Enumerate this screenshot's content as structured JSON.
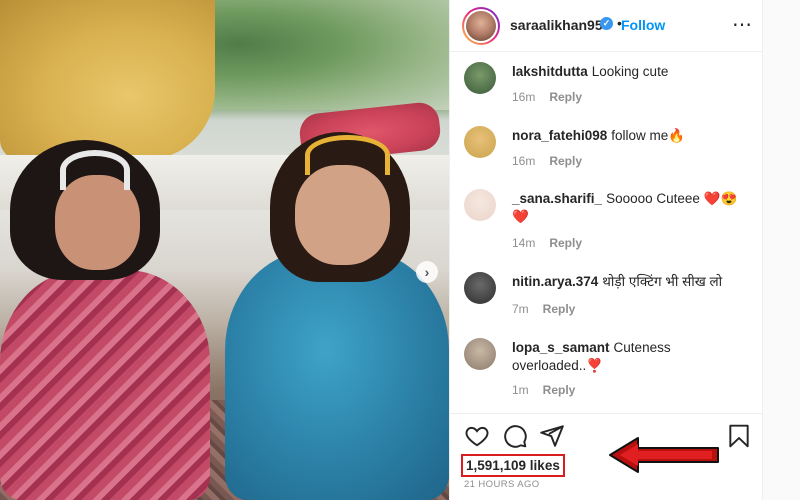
{
  "post": {
    "username": "saraalikhan95",
    "verified": true,
    "separator": "•",
    "follow_label": "Follow",
    "more_label": "⋯",
    "carousel_next": "›"
  },
  "comments": [
    {
      "username": "lakshitdutta",
      "text": "Looking cute",
      "time": "16m",
      "reply": "Reply",
      "avatar_color": "#3a5a3a"
    },
    {
      "username": "nora_fatehi098",
      "text": "follow me🔥",
      "time": "16m",
      "reply": "Reply",
      "avatar_color": "#c9a54a"
    },
    {
      "username": "_sana.sharifi_",
      "text": "Sooooo Cuteee ❤️😍❤️",
      "time": "14m",
      "reply": "Reply",
      "avatar_color": "#e9d3c8"
    },
    {
      "username": "nitin.arya.374",
      "text": "थोड़ी एक्टिंग भी सीख लो",
      "time": "7m",
      "reply": "Reply",
      "avatar_color": "#2d2d2d"
    },
    {
      "username": "lopa_s_samant",
      "text": "Cuteness overloaded..❣️",
      "time": "1m",
      "reply": "Reply",
      "avatar_color": "#8a7a6a"
    }
  ],
  "actions": {
    "icons": [
      "heart-icon",
      "comment-icon",
      "share-icon",
      "bookmark-icon"
    ]
  },
  "likes_text": "1,591,109 likes",
  "time_ago": "21 HOURS AGO",
  "colors": {
    "follow": "#0095f6",
    "highlight": "#d91c1c",
    "verified": "#3897f0"
  }
}
